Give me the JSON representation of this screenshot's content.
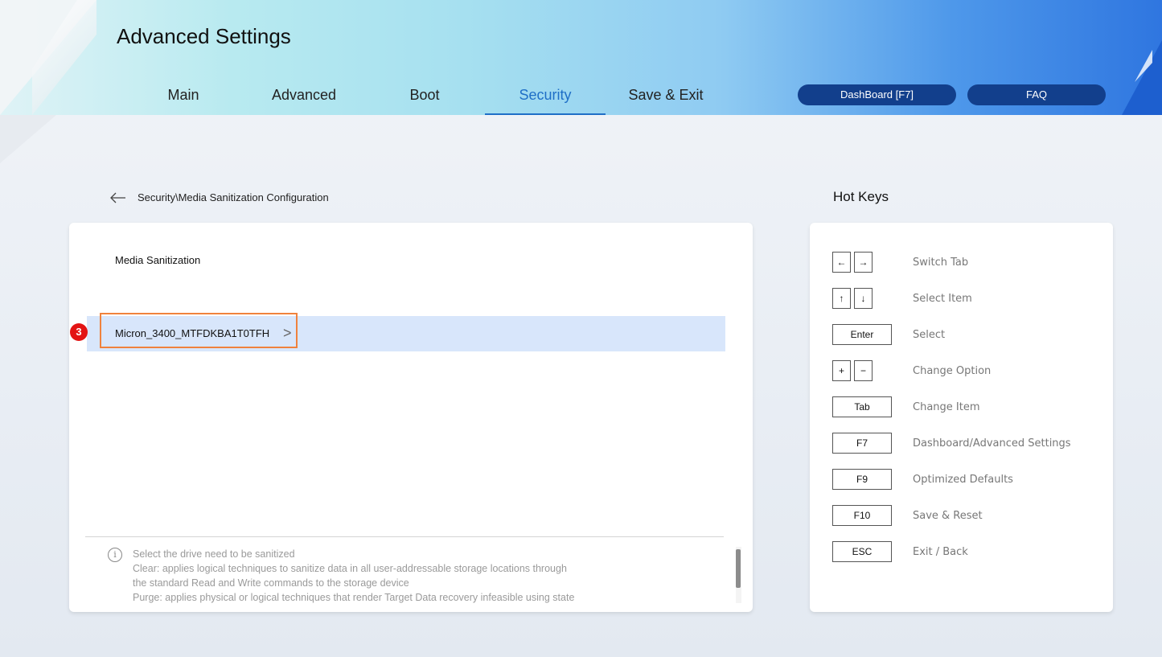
{
  "header": {
    "title": "Advanced Settings",
    "tabs": [
      {
        "label": "Main",
        "active": false
      },
      {
        "label": "Advanced",
        "active": false
      },
      {
        "label": "Boot",
        "active": false
      },
      {
        "label": "Security",
        "active": true
      },
      {
        "label": "Save & Exit",
        "active": false
      }
    ],
    "dashboard_button": "DashBoard [F7]",
    "faq_button": "FAQ"
  },
  "breadcrumb": {
    "back_icon": "arrow-left-icon",
    "path": "Security\\Media Sanitization Configuration"
  },
  "main": {
    "section_label": "Media Sanitization",
    "drive": {
      "label": "Micron_3400_MTFDKBA1T0TFH",
      "chevron": ">",
      "selected": true,
      "step_badge": "3"
    },
    "help": {
      "icon": "info-icon",
      "icon_glyph": "i",
      "lines": [
        "Select the drive need to be sanitized",
        "Clear: applies logical techniques to sanitize data in all user-addressable storage locations through",
        "the standard Read and Write commands to the storage device",
        "Purge: applies physical or logical techniques that render Target Data recovery infeasible using state"
      ]
    }
  },
  "hotkeys": {
    "title": "Hot Keys",
    "items": [
      {
        "keys": [
          "←",
          "→"
        ],
        "desc": "Switch Tab"
      },
      {
        "keys": [
          "↑",
          "↓"
        ],
        "desc": "Select Item"
      },
      {
        "keys": [
          "Enter"
        ],
        "desc": "Select"
      },
      {
        "keys": [
          "+",
          "−"
        ],
        "desc": "Change Option"
      },
      {
        "keys": [
          "Tab"
        ],
        "desc": "Change Item"
      },
      {
        "keys": [
          "F7"
        ],
        "desc": "Dashboard/Advanced Settings"
      },
      {
        "keys": [
          "F9"
        ],
        "desc": "Optimized Defaults"
      },
      {
        "keys": [
          "F10"
        ],
        "desc": "Save & Reset"
      },
      {
        "keys": [
          "ESC"
        ],
        "desc": "Exit / Back"
      }
    ]
  },
  "colors": {
    "accent": "#1f6fc7",
    "button_bg": "#123f8c",
    "selected_row": "#d8e6fb",
    "highlight_border": "#f0823d",
    "badge": "#e31414"
  }
}
